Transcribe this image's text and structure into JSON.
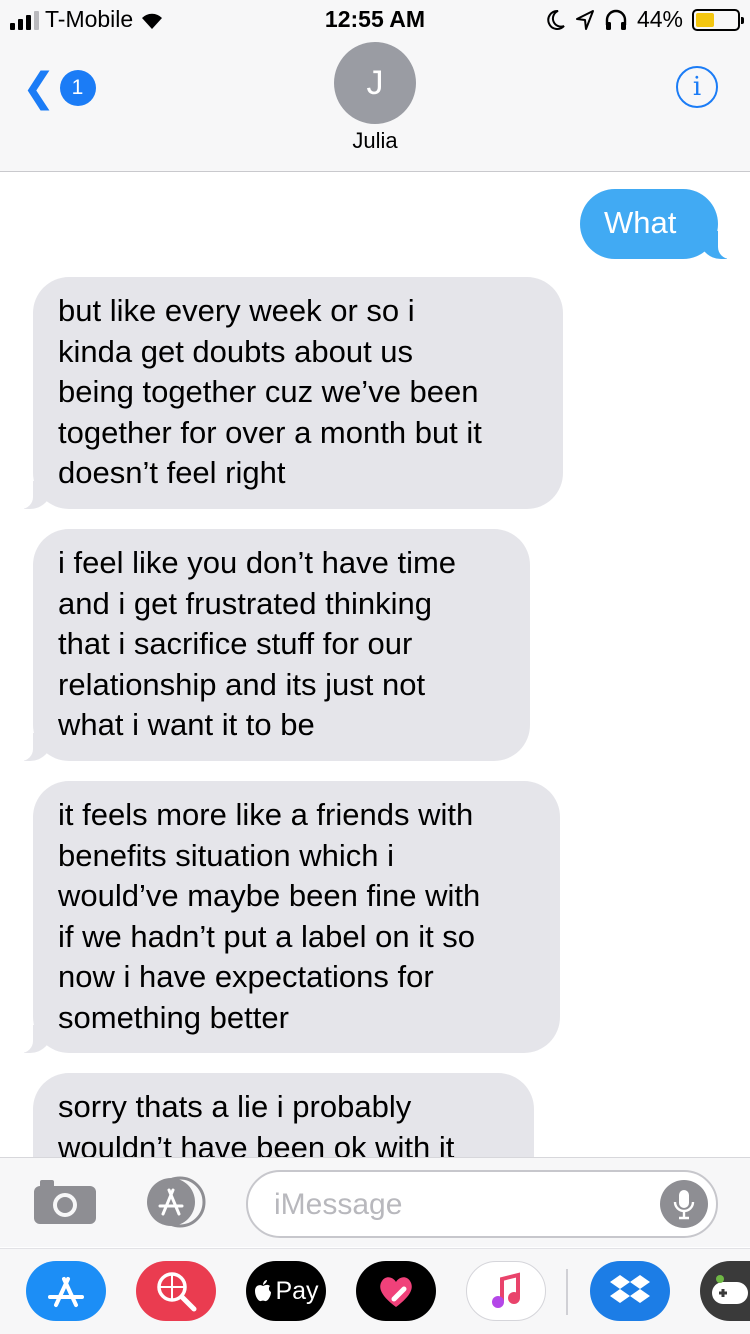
{
  "status_bar": {
    "carrier": "T-Mobile",
    "time": "12:55 AM",
    "battery_percent": "44%",
    "battery_level": 0.44,
    "icons": [
      "signal-icon",
      "wifi-icon",
      "moon-icon",
      "location-arrow-icon",
      "headphones-icon",
      "battery-icon"
    ]
  },
  "header": {
    "back_badge": "1",
    "avatar_initial": "J",
    "contact_name": "Julia",
    "info_glyph": "i"
  },
  "messages": [
    {
      "direction": "sent",
      "lines": [
        "What"
      ]
    },
    {
      "direction": "received",
      "lines": [
        "but like every week or so i",
        "kinda get doubts about us",
        "being together cuz we’ve been",
        "together for over a month but it",
        "doesn’t feel right"
      ]
    },
    {
      "direction": "received",
      "lines": [
        "i feel like you don’t have time",
        "and i get frustrated thinking",
        "that i sacrifice stuff for our",
        "relationship and its just not",
        "what i want it to be"
      ]
    },
    {
      "direction": "received",
      "lines": [
        "it feels more like a friends with",
        "benefits situation which i",
        "would’ve maybe been fine with",
        "if we hadn’t put a label on it so",
        "now i have expectations for",
        "something better"
      ]
    },
    {
      "direction": "received",
      "lines": [
        "sorry thats a lie i probably",
        "wouldn’t have been ok with it"
      ]
    }
  ],
  "input": {
    "placeholder": "iMessage"
  },
  "apps": {
    "pay_label": "Pay",
    "colors": {
      "accent": "#1b7cf6",
      "sent_bubble": "#41aaf3",
      "received_bubble": "#e5e5ea"
    }
  }
}
